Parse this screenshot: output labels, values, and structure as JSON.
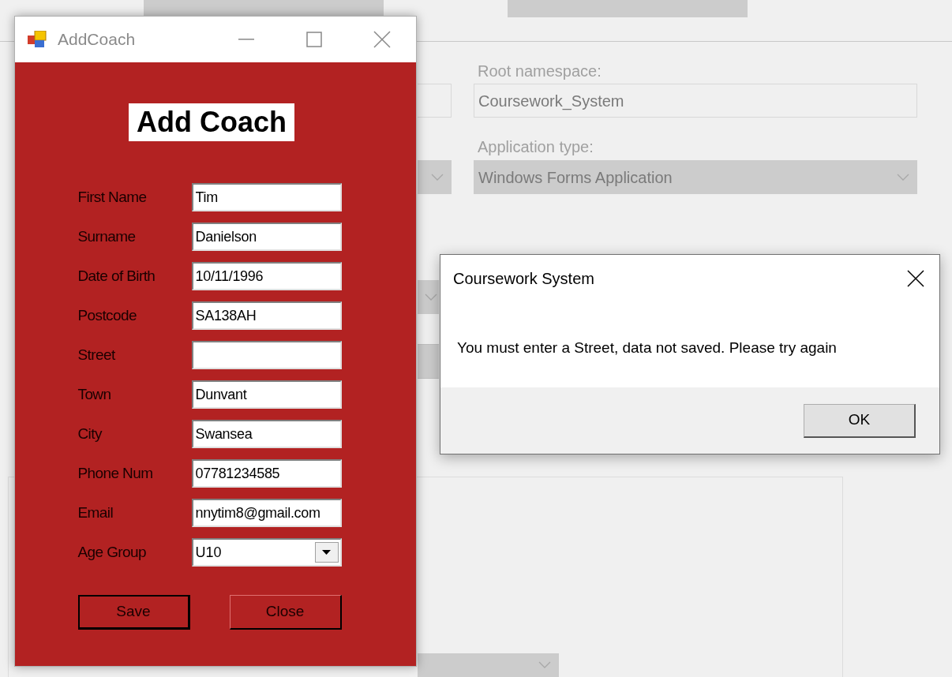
{
  "background": {
    "root_namespace_label": "Root namespace:",
    "root_namespace_value": "Coursework_System",
    "application_type_label": "Application type:",
    "application_type_value": "Windows Forms Application"
  },
  "window": {
    "title": "AddCoach",
    "heading": "Add Coach",
    "fields": [
      {
        "label": "First Name",
        "value": "Tim",
        "kind": "text"
      },
      {
        "label": "Surname",
        "value": "Danielson",
        "kind": "text"
      },
      {
        "label": "Date of Birth",
        "value": "10/11/1996",
        "kind": "text"
      },
      {
        "label": "Postcode",
        "value": "SA138AH",
        "kind": "text"
      },
      {
        "label": "Street",
        "kind": "text"
      },
      {
        "label": "Town",
        "value": "Dunvant",
        "kind": "text"
      },
      {
        "label": "City",
        "value": "Swansea",
        "kind": "text"
      },
      {
        "label": "Phone Num",
        "value": "07781234585",
        "kind": "text"
      },
      {
        "label": "Email",
        "value": "nnytim8@gmail.com",
        "kind": "text"
      },
      {
        "label": "Age Group",
        "value": "U10",
        "kind": "dropdown"
      }
    ],
    "buttons": [
      {
        "label": "Save",
        "default": true
      },
      {
        "label": "Close",
        "default": false
      }
    ]
  },
  "dialog": {
    "title": "Coursework System",
    "message": "You must enter a Street, data not saved. Please try again",
    "button": "OK"
  }
}
